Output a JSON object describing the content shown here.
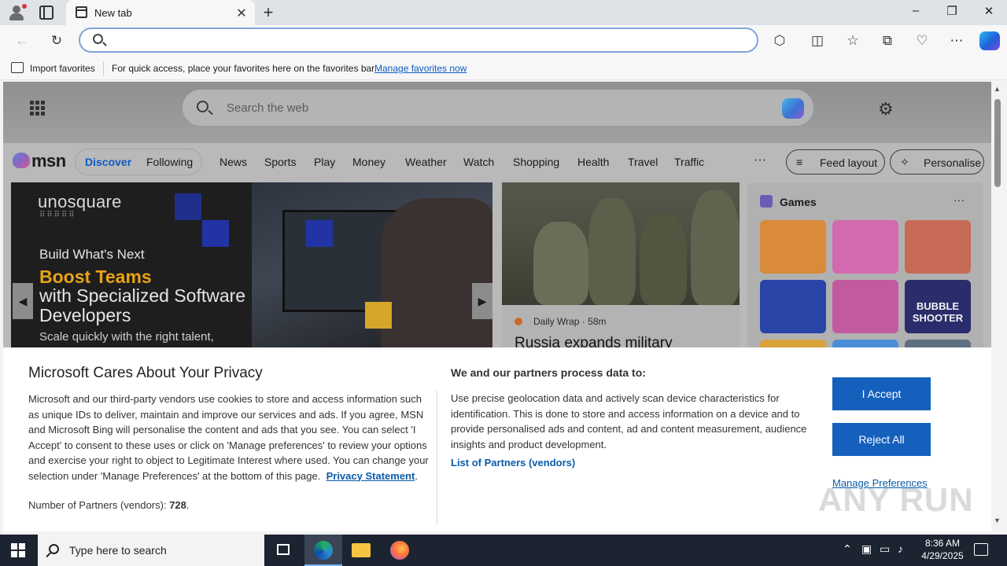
{
  "browser": {
    "tab_title": "New tab",
    "address_value": "",
    "favorites_bar": {
      "import_label": "Import favorites",
      "message": "For quick access, place your favorites here on the favorites bar.",
      "manage_link": "Manage favorites now"
    }
  },
  "msn": {
    "search_placeholder": "Search the web",
    "logo_text": "msn",
    "nav_tabs": [
      "Discover",
      "Following"
    ],
    "nav_links": [
      "News",
      "Sports",
      "Play",
      "Money",
      "Weather",
      "Watch",
      "Shopping",
      "Health",
      "Travel",
      "Traffic"
    ],
    "more_label": "···",
    "feed_layout_label": "Feed layout",
    "personalise_label": "Personalise",
    "hero_ad": {
      "brand": "unosquare",
      "line1": "Build What's Next",
      "line2": "Boost Teams",
      "line3": "with Specialized Software Developers",
      "line4": "Scale quickly with the right talent,"
    },
    "news_card": {
      "source": "Daily Wrap",
      "age": "58m",
      "headline": "Russia expands military"
    },
    "games": {
      "title": "Games",
      "more_label": "···",
      "tiles": [
        {
          "label": "",
          "color": "#d98a3a"
        },
        {
          "label": "",
          "color": "#d36ab0"
        },
        {
          "label": "",
          "color": "#c76a56"
        },
        {
          "label": "",
          "color": "#2a45a8"
        },
        {
          "label": "",
          "color": "#c25aa0"
        },
        {
          "label": "BUBBLE SHOOTER",
          "color": "#2a2d6b"
        }
      ]
    }
  },
  "privacy": {
    "title": "Microsoft Cares About Your Privacy",
    "body": "Microsoft and our third-party vendors use cookies to store and access information such as unique IDs to deliver, maintain and improve our services and ads. If you agree, MSN and Microsoft Bing will personalise the content and ads that you see. You can select 'I Accept' to consent to these uses or click on 'Manage preferences' to review your options and exercise your right to object to Legitimate Interest where used.  You can change your selection under 'Manage Preferences' at the bottom of this page.",
    "privacy_link": "Privacy Statement",
    "partners_label": "Number of Partners (vendors):",
    "partners_count": "728",
    "right_title": "We and our partners process data to:",
    "right_body": "Use precise geolocation data and actively scan device characteristics for identification. This is done to store and access information on a device and to provide personalised ads and content, ad and content measurement, audience insights and product development.",
    "vendors_link": "List of Partners (vendors)",
    "accept_label": "I Accept",
    "reject_label": "Reject All",
    "manage_label": "Manage Preferences",
    "watermark": "ANY RUN"
  },
  "taskbar": {
    "search_placeholder": "Type here to search",
    "time": "8:36 AM",
    "date": "4/29/2025"
  },
  "colors": {
    "accent": "#1560bd",
    "link": "#0b5cab",
    "taskbar": "#1c2431"
  }
}
